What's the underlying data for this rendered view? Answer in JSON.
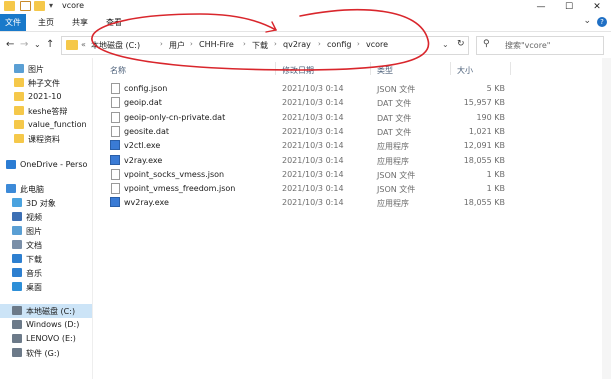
{
  "window": {
    "title": "vcore",
    "minimize": "—",
    "maximize": "☐",
    "close": "✕"
  },
  "ribbon": {
    "tabs": [
      "文件",
      "主页",
      "共享",
      "查看"
    ],
    "expand": "⌄",
    "help": "?"
  },
  "nav": {
    "back": "←",
    "forward": "→",
    "recent": "⌄",
    "up": "↑",
    "overflow": "«",
    "breadcrumb": [
      "本地磁盘 (C:)",
      "用户",
      "CHH-Fire",
      "下载",
      "qv2ray",
      "config",
      "vcore"
    ],
    "refresh": "↻",
    "search_placeholder": "搜索\"vcore\""
  },
  "sidebar": {
    "items": [
      {
        "label": "图片",
        "icon": "pictures-folder-icon",
        "color": "#5a9fd4"
      },
      {
        "label": "种子文件",
        "icon": "folder-icon",
        "color": "#f5c84a"
      },
      {
        "label": "2021-10",
        "icon": "folder-icon",
        "color": "#f5c84a"
      },
      {
        "label": "keshe答辩",
        "icon": "folder-icon",
        "color": "#f5c84a"
      },
      {
        "label": "value_function",
        "icon": "folder-icon",
        "color": "#f5c84a"
      },
      {
        "label": "课程资料",
        "icon": "folder-icon",
        "color": "#f5c84a"
      },
      {
        "label": "OneDrive - Perso",
        "icon": "onedrive-icon",
        "color": "#2b7cd3"
      },
      {
        "label": "此电脑",
        "icon": "this-pc-icon",
        "color": "#3c8ad8"
      },
      {
        "label": "3D 对象",
        "icon": "3d-objects-icon",
        "color": "#4aa3df"
      },
      {
        "label": "视频",
        "icon": "videos-icon",
        "color": "#3c6fb4"
      },
      {
        "label": "图片",
        "icon": "pictures-icon",
        "color": "#5a9fd4"
      },
      {
        "label": "文档",
        "icon": "documents-icon",
        "color": "#7a8fa8"
      },
      {
        "label": "下载",
        "icon": "downloads-icon",
        "color": "#2d7fd0"
      },
      {
        "label": "音乐",
        "icon": "music-icon",
        "color": "#2d7fd0"
      },
      {
        "label": "桌面",
        "icon": "desktop-icon",
        "color": "#2d8fd8"
      },
      {
        "label": "本地磁盘 (C:)",
        "icon": "drive-icon",
        "color": "#6c7a89"
      },
      {
        "label": "Windows (D:)",
        "icon": "drive-icon",
        "color": "#6c7a89"
      },
      {
        "label": "LENOVO (E:)",
        "icon": "drive-icon",
        "color": "#6c7a89"
      },
      {
        "label": "软件 (G:)",
        "icon": "drive-icon",
        "color": "#6c7a89"
      }
    ]
  },
  "columns": {
    "name": "名称",
    "date": "修改日期",
    "type": "类型",
    "size": "大小"
  },
  "files": [
    {
      "name": "config.json",
      "date": "2021/10/3 0:14",
      "type": "JSON 文件",
      "size": "5 KB",
      "icon": "file-icon"
    },
    {
      "name": "geoip.dat",
      "date": "2021/10/3 0:14",
      "type": "DAT 文件",
      "size": "15,957 KB",
      "icon": "file-icon"
    },
    {
      "name": "geoip-only-cn-private.dat",
      "date": "2021/10/3 0:14",
      "type": "DAT 文件",
      "size": "190 KB",
      "icon": "file-icon"
    },
    {
      "name": "geosite.dat",
      "date": "2021/10/3 0:14",
      "type": "DAT 文件",
      "size": "1,021 KB",
      "icon": "file-icon"
    },
    {
      "name": "v2ctl.exe",
      "date": "2021/10/3 0:14",
      "type": "应用程序",
      "size": "12,091 KB",
      "icon": "exe-icon"
    },
    {
      "name": "v2ray.exe",
      "date": "2021/10/3 0:14",
      "type": "应用程序",
      "size": "18,055 KB",
      "icon": "exe-icon"
    },
    {
      "name": "vpoint_socks_vmess.json",
      "date": "2021/10/3 0:14",
      "type": "JSON 文件",
      "size": "1 KB",
      "icon": "file-icon"
    },
    {
      "name": "vpoint_vmess_freedom.json",
      "date": "2021/10/3 0:14",
      "type": "JSON 文件",
      "size": "1 KB",
      "icon": "file-icon"
    },
    {
      "name": "wv2ray.exe",
      "date": "2021/10/3 0:14",
      "type": "应用程序",
      "size": "18,055 KB",
      "icon": "exe-icon"
    }
  ],
  "colors": {
    "accent": "#1979ca",
    "selection": "#cce4f7",
    "annotation": "#d9262c"
  }
}
